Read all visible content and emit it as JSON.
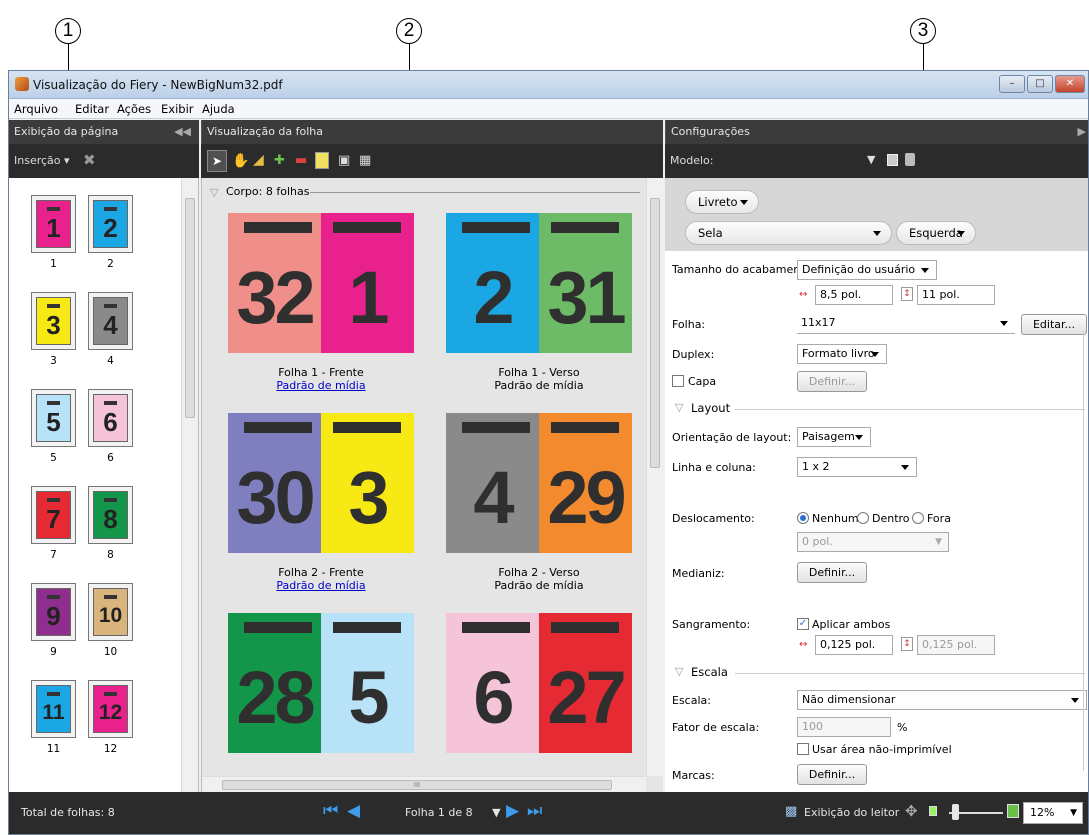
{
  "callouts": [
    "1",
    "2",
    "3"
  ],
  "window": {
    "title": "Visualização do Fiery - NewBigNum32.pdf",
    "menu": [
      "Arquivo",
      "Editar",
      "Ações",
      "Exibir",
      "Ajuda"
    ]
  },
  "left_panel": {
    "header": "Exibição da página",
    "insert_label": "Inserção",
    "pages": [
      {
        "num": "1",
        "label": "1",
        "color": "#e8218c"
      },
      {
        "num": "2",
        "label": "2",
        "color": "#1aa7e3"
      },
      {
        "num": "3",
        "label": "3",
        "color": "#f7ea14"
      },
      {
        "num": "4",
        "label": "4",
        "color": "#8a8a8a"
      },
      {
        "num": "5",
        "label": "5",
        "color": "#b8e2f7"
      },
      {
        "num": "6",
        "label": "6",
        "color": "#f6c4d8"
      },
      {
        "num": "7",
        "label": "7",
        "color": "#e52a34"
      },
      {
        "num": "8",
        "label": "8",
        "color": "#14964a"
      },
      {
        "num": "9",
        "label": "9",
        "color": "#8f2e8e"
      },
      {
        "num": "10",
        "label": "10",
        "color": "#d9b47c"
      },
      {
        "num": "11",
        "label": "11",
        "color": "#1aa7e3"
      },
      {
        "num": "12",
        "label": "12",
        "color": "#e8218c"
      }
    ]
  },
  "center_panel": {
    "header": "Visualização da folha",
    "body_label": "Corpo: 8 folhas",
    "sheets": [
      {
        "left": {
          "num": "32",
          "color": "#f08f8a"
        },
        "right": {
          "num": "1",
          "color": "#e8218c"
        },
        "caption": "Folha 1 - Frente",
        "media": "Padrão de mídia",
        "link": true
      },
      {
        "left": {
          "num": "2",
          "color": "#1aa7e3"
        },
        "right": {
          "num": "31",
          "color": "#6dbb66"
        },
        "caption": "Folha 1 - Verso",
        "media": "Padrão de mídia",
        "link": false
      },
      {
        "left": {
          "num": "30",
          "color": "#7f7fc0"
        },
        "right": {
          "num": "3",
          "color": "#f7ea14"
        },
        "caption": "Folha 2 - Frente",
        "media": "Padrão de mídia",
        "link": true
      },
      {
        "left": {
          "num": "4",
          "color": "#8a8a8a"
        },
        "right": {
          "num": "29",
          "color": "#f38b2e"
        },
        "caption": "Folha 2 - Verso",
        "media": "Padrão de mídia",
        "link": false
      },
      {
        "left": {
          "num": "28",
          "color": "#14964a"
        },
        "right": {
          "num": "5",
          "color": "#b8e2f7"
        },
        "caption": "",
        "media": "",
        "link": false
      },
      {
        "left": {
          "num": "6",
          "color": "#f6c4d8"
        },
        "right": {
          "num": "27",
          "color": "#e52a34"
        },
        "caption": "",
        "media": "",
        "link": false
      }
    ],
    "scroll_glyph": "III"
  },
  "right_panel": {
    "header": "Configurações",
    "model_label": "Modelo:",
    "booklet": "Livreto",
    "binding": "Sela",
    "side": "Esquerda",
    "finish_size_label": "Tamanho do acabamento:",
    "finish_size_value": "Definição do usuário",
    "width": "8,5 pol.",
    "height": "11 pol.",
    "sheet_label": "Folha:",
    "sheet_value": "11x17",
    "edit_button": "Editar...",
    "duplex_label": "Duplex:",
    "duplex_value": "Formato livro",
    "cover_label": "Capa",
    "define_button": "Definir...",
    "layout_section": "Layout",
    "orientation_label": "Orientação de layout:",
    "orientation_value": "Paisagem",
    "rowcol_label": "Linha e coluna:",
    "rowcol_value": "1 x 2",
    "shift_label": "Deslocamento:",
    "shift_options": [
      "Nenhum",
      "Dentro",
      "Fora"
    ],
    "shift_value": "0 pol.",
    "gutter_label": "Medianiz:",
    "bleed_label": "Sangramento:",
    "apply_both": "Aplicar ambos",
    "bleed_w": "0,125 pol.",
    "bleed_h": "0,125 pol.",
    "scale_section": "Escala",
    "scale_label": "Escala:",
    "scale_value": "Não dimensionar",
    "factor_label": "Fator de escala:",
    "factor_value": "100",
    "percent": "%",
    "nonprint_label": "Usar área não-imprimível",
    "marks_label": "Marcas:"
  },
  "status": {
    "total": "Total de folhas: 8",
    "page_nav": "Folha 1 de 8",
    "reader_view": "Exibição do leitor",
    "zoom": "12%"
  }
}
